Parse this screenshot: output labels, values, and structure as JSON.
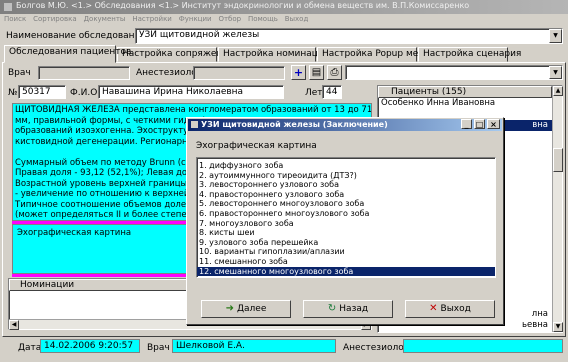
{
  "window": {
    "title": "Болгов М.Ю. <1.> Обследования <1.> Институт эндокринологии и обмена веществ им. В.П.Комиссаренко"
  },
  "menu": [
    "Поиск",
    "Сортировка",
    "Документы",
    "Настройки",
    "Функции",
    "Отбор",
    "Помощь",
    "Выход"
  ],
  "exam": {
    "label": "Наименование обследования",
    "value": "УЗИ щитовидной железы"
  },
  "tabs": [
    "Обследования пациентов",
    "Настройка сопряжений",
    "Настройка номинаций",
    "Настройка Popup меню",
    "Настройка сценария"
  ],
  "staff": {
    "doctor_label": "Врач",
    "anesth_label": "Анестезиолог",
    "plus": "+"
  },
  "patient": {
    "no_label": "№",
    "no_value": "50317",
    "fio_label": "Ф.И.О.",
    "fio_value": "Навашина Ирина Николаевна",
    "age_label": "Лет",
    "age_value": "44"
  },
  "report_text": [
    "ЩИТОВИДНАЯ ЖЕЛЕЗА представлена конгломератом образований от 13 до 71",
    "мм, правильной формы, с четкими гидроф",
    "образований изоэхогенна. Эхоструктура",
    "кистовидной дегенерации. Регионарные",
    "",
    "Суммарный объем по методу Brunn (cm.куб",
    "Правая доля - 93,12 (52,1%); Левая доля - 85",
    "Возрастной уровень верхней границы об",
    "- увеличение по отношению к верхней гран",
    "Типичное соотношение объемов долей не",
    "(может определяться II и более степень к"
  ],
  "echo_section_label": "Эхографическая картина",
  "nominations_label": "Номинации",
  "patients": {
    "header": "Пациенты (155)",
    "rows": [
      "Особенко Инна Ивановна",
      "",
      "вна",
      "",
      "",
      "",
      "",
      "",
      "",
      "",
      "",
      "",
      "",
      "",
      "",
      "",
      "",
      "",
      "",
      "",
      "",
      "",
      "",
      "лна",
      "ьевна"
    ],
    "selected_index": 2
  },
  "footer": {
    "date_label": "Дата",
    "date_value": "14.02.2006 9:20:57",
    "doctor_label": "Врач",
    "doctor_value": "Шелковой Е.А.",
    "anesth_label": "Анестезиолог"
  },
  "dialog": {
    "title": "УЗИ щитовидной железы (Заключение)",
    "heading": "Эхографическая картина",
    "items": [
      "1. диффузного зоба",
      "2. аутоиммунного тиреоидита (ДТЗ?)",
      "3. левостороннего узлового зоба",
      "4. правостороннего узлового зоба",
      "5. левостороннего многоузлового зоба",
      "6. правостороннего многоузлового зоба",
      "7. многоузлового зоба",
      "8. кисты шеи",
      "9. узлового зоба перешейка",
      "10. варианты гипоплазии/аплазии",
      "11. смешанного зоба",
      "12. смешанного многоузлового зоба"
    ],
    "selected_index": 11,
    "buttons": {
      "next": "Далее",
      "back": "Назад",
      "exit": "Выход"
    },
    "colors": {
      "next_icon": "#2a7a1a",
      "back_icon": "#1a7a3a",
      "exit_icon": "#c00000"
    }
  }
}
